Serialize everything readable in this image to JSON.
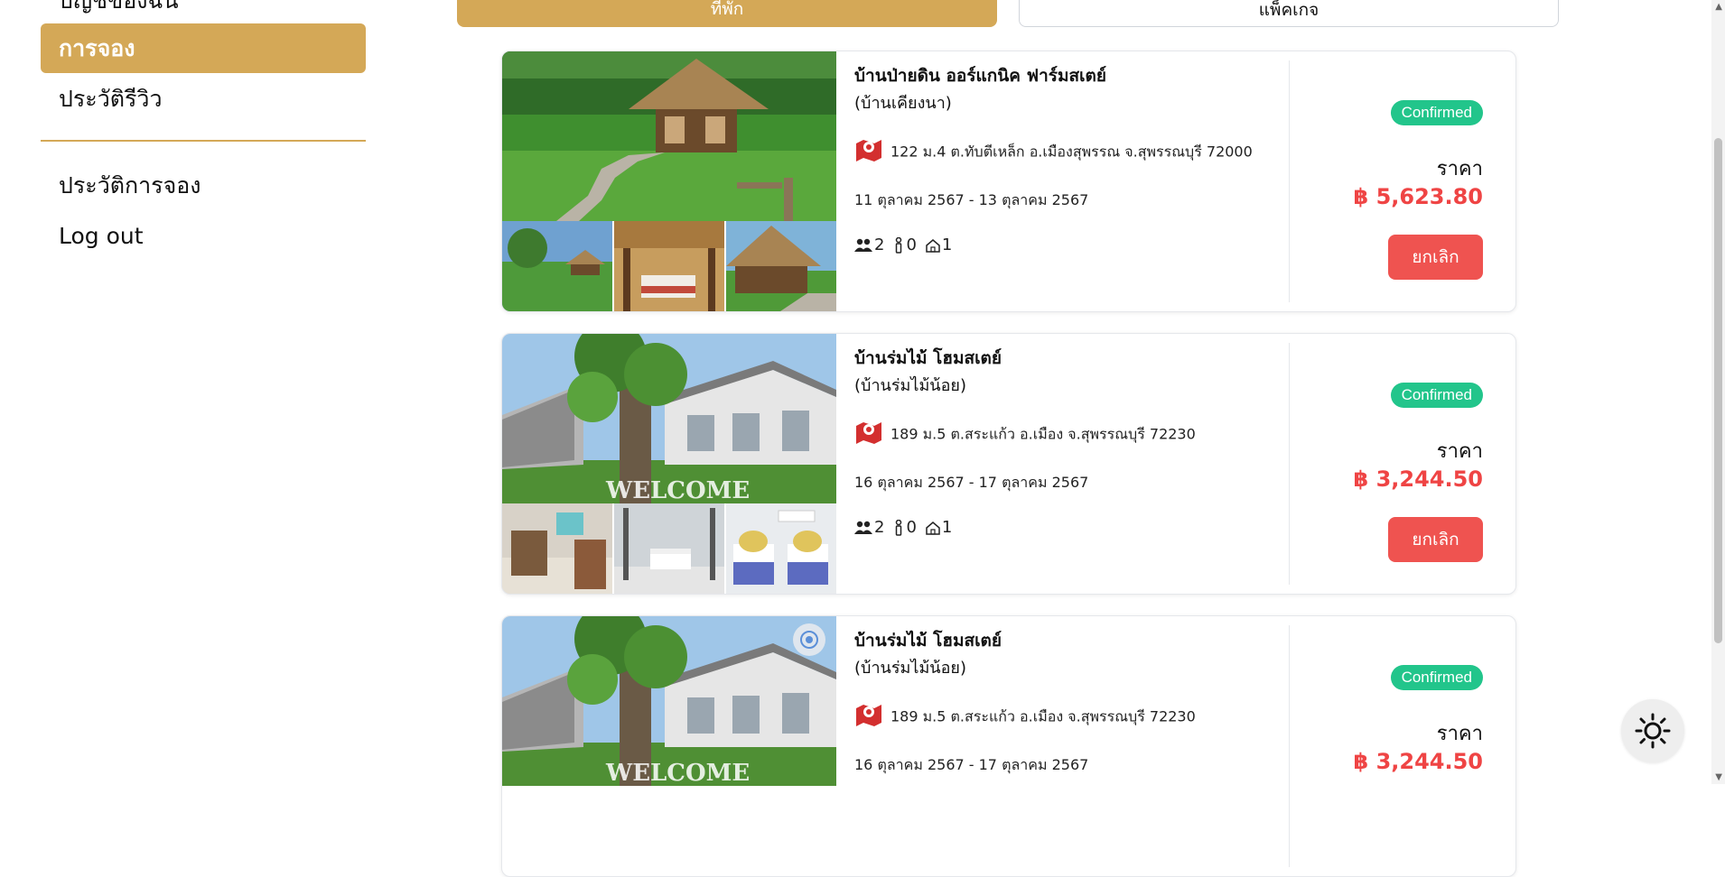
{
  "sidebar": {
    "partial_label": "บัญชีของฉัน",
    "active_label": "การจอง",
    "review_label": "ประวัติรีวิว",
    "history_label": "ประวัติการจอง",
    "logout_label": "Log out"
  },
  "tabs": {
    "stay": "ที่พัก",
    "package": "แพ็คเกจ"
  },
  "bookings": [
    {
      "name": "บ้านป่ายดิน ออร์แกนิค ฟาร์มสเตย์",
      "subname": "(บ้านเคียงนา)",
      "address": "122 ม.4 ต.ทับตีเหล็ก อ.เมืองสุพรรณ จ.สุพรรณบุรี 72000",
      "dates": "11 ตุลาคม 2567 - 13 ตุลาคม 2567",
      "adults": "2",
      "children": "0",
      "rooms": "1",
      "status": "Confirmed",
      "price_label": "ราคา",
      "price": "฿ 5,623.80",
      "cancel": "ยกเลิก"
    },
    {
      "name": "บ้านร่มไม้ โฮมสเตย์",
      "subname": "(บ้านร่มไม้น้อย)",
      "address": "189 ม.5 ต.สระแก้ว อ.เมือง จ.สุพรรณบุรี 72230",
      "dates": "16 ตุลาคม 2567 - 17 ตุลาคม 2567",
      "adults": "2",
      "children": "0",
      "rooms": "1",
      "status": "Confirmed",
      "price_label": "ราคา",
      "price": "฿ 3,244.50",
      "cancel": "ยกเลิก"
    },
    {
      "name": "บ้านร่มไม้ โฮมสเตย์",
      "subname": "(บ้านร่มไม้น้อย)",
      "address": "189 ม.5 ต.สระแก้ว อ.เมือง จ.สุพรรณบุรี 72230",
      "dates": "16 ตุลาคม 2567 - 17 ตุลาคม 2567",
      "status": "Confirmed",
      "price_label": "ราคา",
      "price": "฿ 3,244.50"
    }
  ],
  "welcome_sign": "WELCOME",
  "colors": {
    "accent": "#d4a857",
    "confirmed": "#22c58b",
    "price": "#ef4444",
    "cancel": "#ef5350"
  },
  "icons": [
    "map-pin-icon",
    "people-icon",
    "child-icon",
    "room-icon",
    "sun-icon",
    "camera-icon"
  ]
}
